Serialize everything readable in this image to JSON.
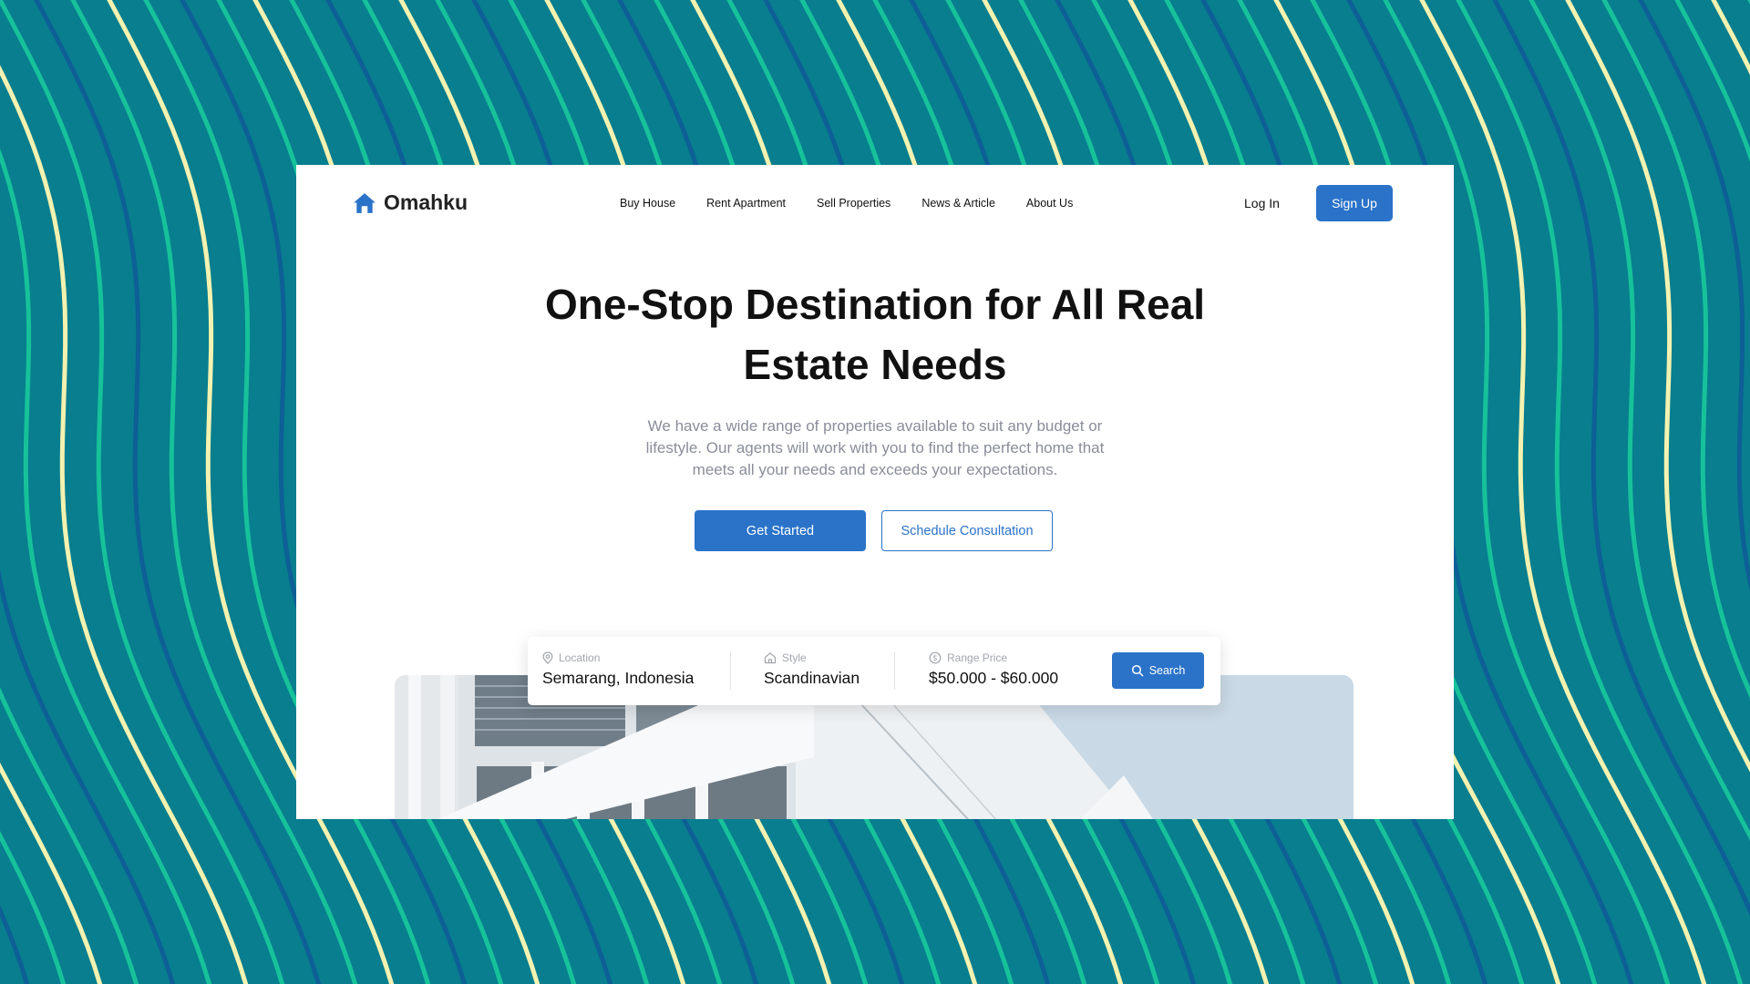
{
  "brand": {
    "name": "Omahku",
    "icon": "house-icon",
    "color": "#2a73c9"
  },
  "nav": {
    "links": [
      "Buy House",
      "Rent Apartment",
      "Sell Properties",
      "News & Article",
      "About Us"
    ],
    "login_label": "Log In",
    "signup_label": "Sign Up"
  },
  "hero": {
    "title": "One-Stop Destination for All Real Estate Needs",
    "description": "We have a wide range of properties available to suit any budget or lifestyle. Our agents will work with you to find the perfect home that meets all your needs and exceeds your expectations.",
    "primary_cta": "Get Started",
    "secondary_cta": "Schedule Consultation"
  },
  "search": {
    "location": {
      "label": "Location",
      "value": "Semarang, Indonesia",
      "icon": "location-pin-icon"
    },
    "style": {
      "label": "Style",
      "value": "Scandinavian",
      "icon": "house-outline-icon"
    },
    "price": {
      "label": "Range Price",
      "value": "$50.000 - $60.000",
      "icon": "dollar-circle-icon"
    },
    "button_label": "Search",
    "button_icon": "search-icon"
  },
  "colors": {
    "background": "#087e8f",
    "accent": "#2a73c9",
    "wave_light": "#f3f2b0",
    "wave_green": "#17c29a",
    "wave_blue": "#0d5f96"
  }
}
